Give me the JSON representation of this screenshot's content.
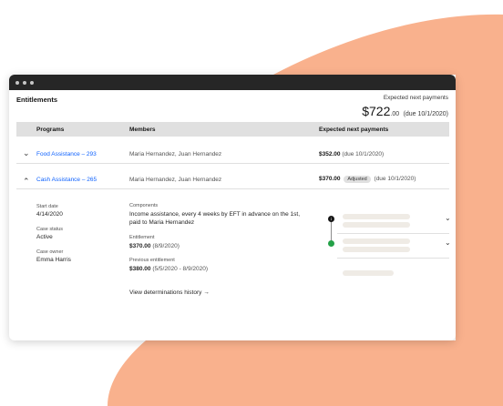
{
  "colors": {
    "accent_blob": "#f9b18d",
    "link": "#0f62fe",
    "titlebar": "#262626",
    "success": "#24a148"
  },
  "window": {
    "controls": [
      "dot",
      "dot",
      "dot"
    ]
  },
  "page": {
    "title": "Entitlements",
    "next_payments_label": "Expected next payments",
    "next_payments_amount": "$722",
    "next_payments_cents": ".00",
    "next_payments_due": "(due 10/1/2020)"
  },
  "table": {
    "headers": {
      "programs": "Programs",
      "members": "Members",
      "expected": "Expected next payments"
    },
    "rows": [
      {
        "program": "Food Assistance – 293",
        "members": "Maria Hernandez, Juan Hernandez",
        "amount": "$352.00",
        "due": "(due 10/1/2020)",
        "expanded": false
      },
      {
        "program": "Cash Assistance – 265",
        "members": "Maria Hernandez, Juan Hernandez",
        "amount": "$370.00",
        "tag": "Adjusted",
        "due": "(due 10/1/2020)",
        "expanded": true
      }
    ]
  },
  "detail": {
    "start_date_label": "Start date",
    "start_date": "4/14/2020",
    "case_status_label": "Case status",
    "case_status": "Active",
    "case_owner_label": "Case owner",
    "case_owner": "Emma Harris",
    "components_label": "Components",
    "components_line1": "Income assistance, every 4 weeks by EFT in advance on the 1st,",
    "components_line2": "paid to Maria Hernandez",
    "entitlement_label": "Entitlement",
    "entitlement_amount": "$370.00",
    "entitlement_period": "(8/9/2020)",
    "previous_label": "Previous entitlement",
    "previous_amount": "$380.00",
    "previous_period": "(5/5/2020 - 8/9/2020)",
    "history_link": "View determinations history",
    "timeline_node_label": "i"
  },
  "icons": {
    "expand": "chevron-down-icon",
    "collapse": "chevron-up-icon",
    "link_arrow": "arrow-right-icon"
  }
}
